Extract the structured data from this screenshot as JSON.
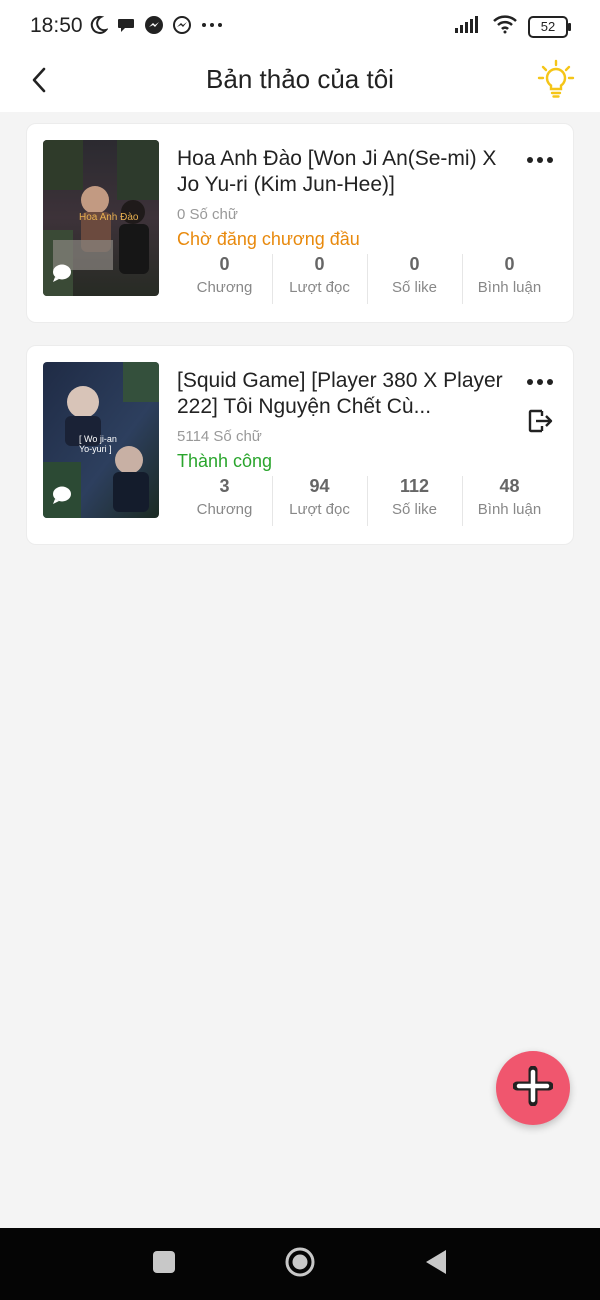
{
  "status_bar": {
    "time": "18:50",
    "battery": "52",
    "icons": [
      "moon-icon",
      "chat-bubble-icon",
      "messenger-icon",
      "messenger-outline-icon",
      "more-dots-icon",
      "signal-icon",
      "wifi-icon",
      "battery-icon"
    ]
  },
  "header": {
    "title": "Bản thảo của tôi",
    "back_icon": "chevron-left-icon",
    "tip_icon": "lightbulb-icon",
    "accent": "#f5c518"
  },
  "drafts": [
    {
      "title": "Hoa Anh Đào [Won Ji An(Se-mi) X Jo Yu-ri (Kim Jun-Hee)]",
      "word_count": "0 Số chữ",
      "status": "Chờ đăng chương đầu",
      "status_color": "#e8890c",
      "cover_text": "Hoa Anh Đào",
      "stats": [
        {
          "value": "0",
          "label": "Chương"
        },
        {
          "value": "0",
          "label": "Lượt đọc"
        },
        {
          "value": "0",
          "label": "Số like"
        },
        {
          "value": "0",
          "label": "Bình luận"
        }
      ]
    },
    {
      "title": "[Squid Game] [Player 380 X Player 222] Tôi Nguyện Chết Cù...",
      "word_count": "5114 Số chữ",
      "status": "Thành công",
      "status_color": "#2aa52d",
      "cover_text": "[ Wo ji-an\nYo-yuri ]",
      "stats": [
        {
          "value": "3",
          "label": "Chương"
        },
        {
          "value": "94",
          "label": "Lượt đọc"
        },
        {
          "value": "112",
          "label": "Số like"
        },
        {
          "value": "48",
          "label": "Bình luận"
        }
      ]
    }
  ],
  "fab": {
    "icon": "plus-icon",
    "color": "#f0566e"
  },
  "nav_bar": {
    "icons": [
      "recent-apps-icon",
      "home-icon",
      "back-triangle-icon"
    ]
  }
}
